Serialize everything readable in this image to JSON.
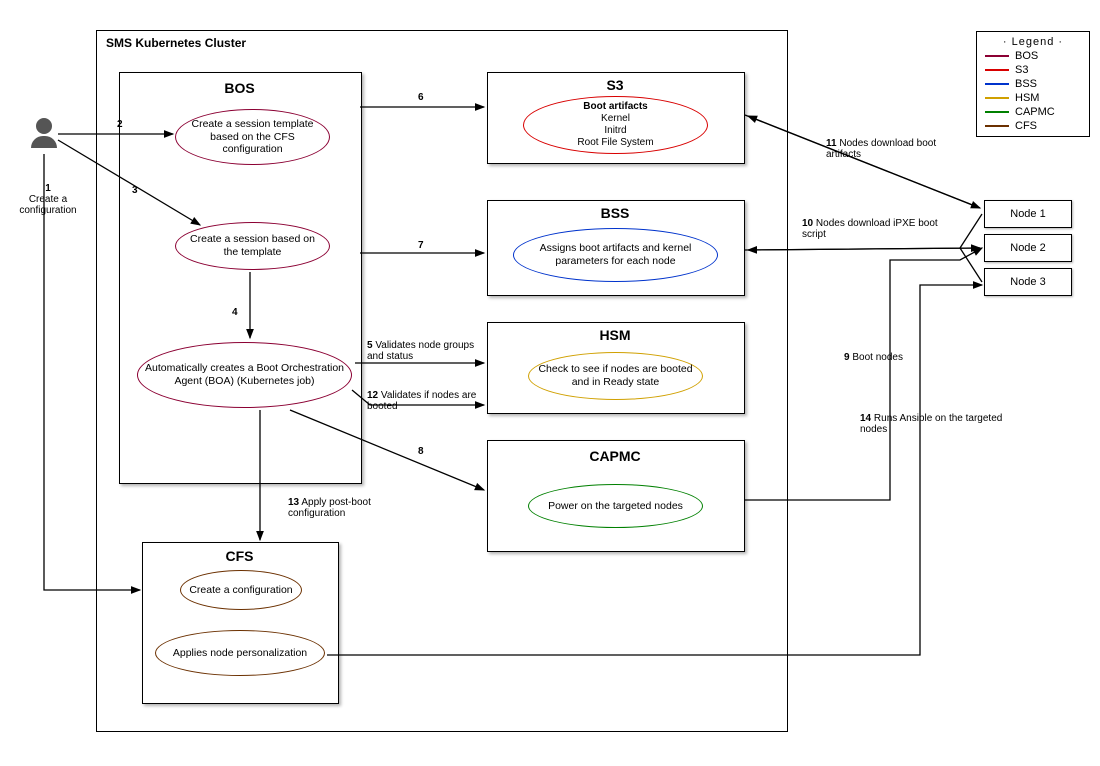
{
  "cluster": {
    "title": "SMS Kubernetes Cluster"
  },
  "bos": {
    "title": "BOS",
    "e1": "Create a session template based on the CFS configuration",
    "e2": "Create a session based on the template",
    "e3": "Automatically creates a Boot Orchestration Agent (BOA) (Kubernetes job)"
  },
  "s3": {
    "title": "S3",
    "head": "Boot artifacts",
    "l1": "Kernel",
    "l2": "Initrd",
    "l3": "Root File System"
  },
  "bss": {
    "title": "BSS",
    "e1": "Assigns boot artifacts and kernel parameters for each node"
  },
  "hsm": {
    "title": "HSM",
    "e1": "Check to see if nodes are booted and in Ready state"
  },
  "capmc": {
    "title": "CAPMC",
    "e1": "Power on the targeted nodes"
  },
  "cfs": {
    "title": "CFS",
    "e1": "Create a configuration",
    "e2": "Applies node personalization"
  },
  "nodes": {
    "n1": "Node 1",
    "n2": "Node 2",
    "n3": "Node 3"
  },
  "steps": {
    "s1a": "1",
    "s1b": "Create a configuration",
    "s2": "2",
    "s3": "3",
    "s4": "4",
    "s5a": "5",
    "s5b": "Validates node groups and status",
    "s6": "6",
    "s7": "7",
    "s8": "8",
    "s9a": "9",
    "s9b": "Boot nodes",
    "s10a": "10",
    "s10b": "Nodes download iPXE boot script",
    "s11a": "11",
    "s11b": "Nodes download boot artifacts",
    "s12a": "12",
    "s12b": "Validates if nodes are booted",
    "s13a": "13",
    "s13b": "Apply post-boot configuration",
    "s14a": "14",
    "s14b": "Runs Ansible on the targeted nodes"
  },
  "legend": {
    "title": "Legend",
    "bos": "BOS",
    "s3": "S3",
    "bss": "BSS",
    "hsm": "HSM",
    "capmc": "CAPMC",
    "cfs": "CFS"
  }
}
